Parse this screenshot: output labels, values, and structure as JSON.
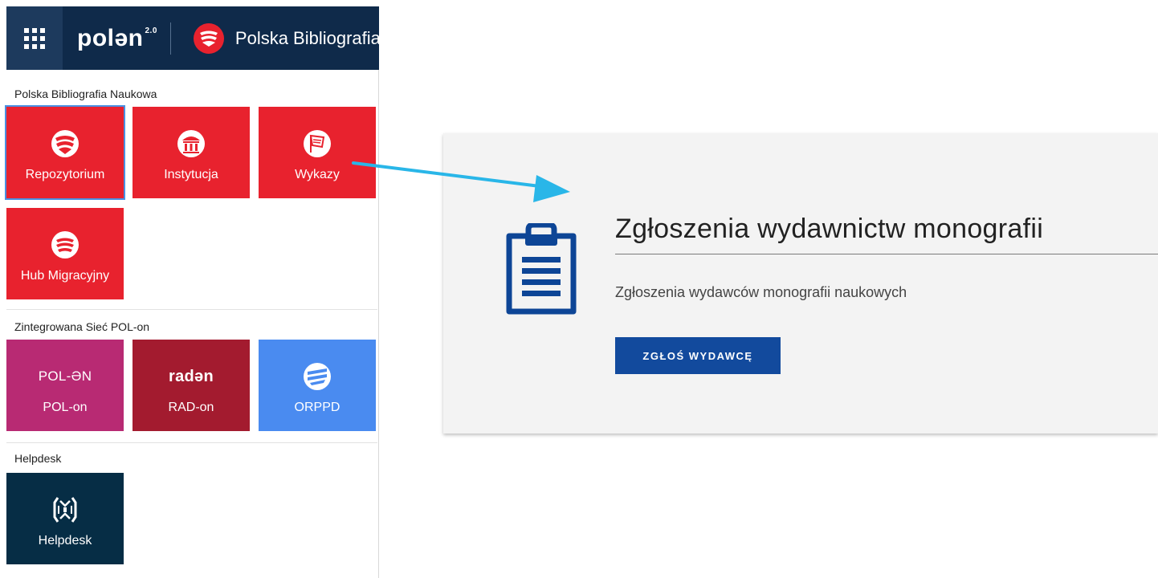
{
  "header": {
    "logo_text": "polən",
    "logo_version": "2.0",
    "app_title": "Polska Bibliografia Naukowa"
  },
  "menu": {
    "sections": [
      {
        "label": "Polska Bibliografia Naukowa",
        "tiles": [
          {
            "label": "Repozytorium",
            "color": "#e8222e",
            "icon": "pbn-logo-icon"
          },
          {
            "label": "Instytucja",
            "color": "#e8222e",
            "icon": "institution-icon"
          },
          {
            "label": "Wykazy",
            "color": "#e8222e",
            "icon": "flag-icon"
          },
          {
            "label": "Hub Migracyjny",
            "color": "#e8222e",
            "icon": "hub-icon"
          }
        ]
      },
      {
        "label": "Zintegrowana Sieć POL-on",
        "tiles": [
          {
            "label": "POL-on",
            "logo": "POL-ƏN",
            "color": "#b82a73"
          },
          {
            "label": "RAD-on",
            "logo": "radən",
            "color": "#a31b2f"
          },
          {
            "label": "ORPPD",
            "color": "#4a8bf0",
            "icon": "orppd-icon"
          }
        ]
      },
      {
        "label": "Helpdesk",
        "tiles": [
          {
            "label": "Helpdesk",
            "color": "#062d45",
            "icon": "helpdesk-icon"
          }
        ]
      }
    ]
  },
  "card": {
    "title": "Zgłoszenia wydawnictw monografii",
    "description": "Zgłoszenia wydawców monografii naukowych",
    "button_label": "ZGŁOŚ WYDAWCĘ",
    "icon": "clipboard-icon"
  },
  "colors": {
    "header_bg": "#0f2a4a",
    "accent_red": "#e8222e",
    "button_blue": "#124a9d",
    "arrow": "#29b6e8"
  }
}
